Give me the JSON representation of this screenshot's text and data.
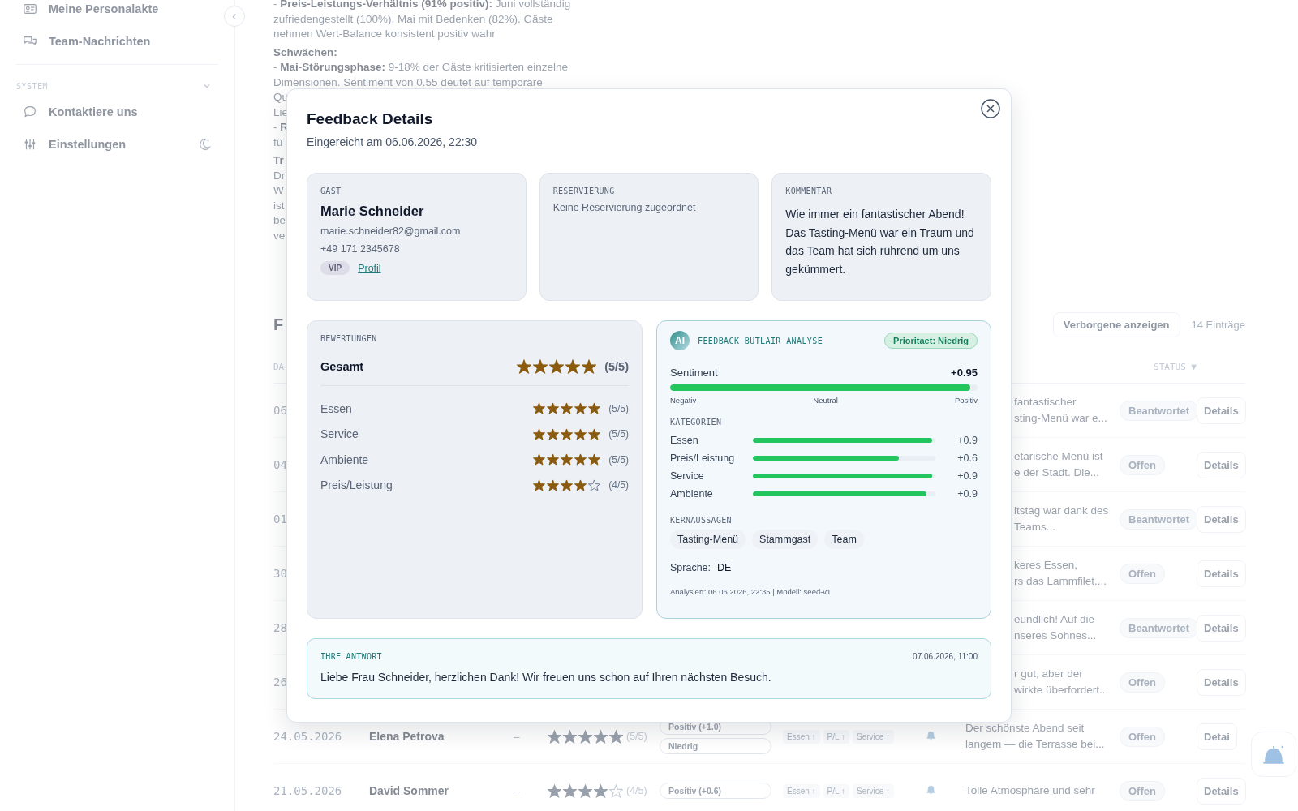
{
  "sidebar": {
    "collapse_toggle": "‹",
    "groups": [
      {
        "items": [
          {
            "label": "Meine Personalakte"
          },
          {
            "label": "Team-Nachrichten"
          }
        ]
      },
      {
        "title": "SYSTEM",
        "expanded": true,
        "items": [
          {
            "label": "Kontaktiere uns"
          },
          {
            "label": "Einstellungen"
          }
        ]
      }
    ]
  },
  "report": {
    "paragraphs": [
      {
        "lines": [
          "- **Preis-Leistungs-Verhältnis (91% positiv):** Juni vollständig",
          "zufriedengestellt (100%), Mai mit Bedenken (82%). Gäste",
          "nehmen Wert-Balance konsistent positiv wahr"
        ]
      },
      {
        "lines": [
          "**Schwächen:**",
          "- **Mai-Störungsphase:** 9-18% der Gäste kritisierten einzelne",
          "Dimensionen. Sentiment von 0.55 deutet auf temporäre",
          "Qu",
          "Lie",
          "- **R**",
          "fü"
        ]
      },
      {
        "lines": [
          "**Tr**",
          "Dr",
          "W",
          "ist",
          "be",
          "ve"
        ]
      }
    ]
  },
  "feedback_list": {
    "title": "F",
    "hidden_toggle": "Verborgene anzeigen",
    "count": "14 Einträge",
    "columns": [
      {
        "label": "DA"
      },
      {
        "label": "STATUS",
        "sort_indicator": "▼"
      }
    ],
    "rows": [
      {
        "date": "06",
        "comment_lines": [
          "fantastischer",
          "sting-Menü war e..."
        ],
        "status": "Beantwortet",
        "action": "Details"
      },
      {
        "date": "04",
        "comment_lines": [
          "etarische Menü ist",
          "e der Stadt. Die..."
        ],
        "status": "Offen",
        "action": "Details"
      },
      {
        "date": "01",
        "comment_lines": [
          "itstag war dank des",
          "Teams..."
        ],
        "status": "Beantwortet",
        "action": "Details"
      },
      {
        "date": "30",
        "comment_lines": [
          "keres Essen,",
          "rs das Lammfilet...."
        ],
        "status": "Offen",
        "action": "Details"
      },
      {
        "date": "28",
        "comment_lines": [
          "eundlich! Auf die",
          "nseres Sohnes..."
        ],
        "status": "Beantwortet",
        "action": "Details"
      },
      {
        "date": "26",
        "comment_lines": [
          "r gut, aber der",
          "wirkte überfordert..."
        ],
        "status": "Offen",
        "action": "Details"
      },
      {
        "date": "24.05.2026",
        "name": "Elena Petrova",
        "reservation": "–",
        "stars": 5,
        "score": "(5/5)",
        "sentiment": "Positiv (+1.0)",
        "priority": "Niedrig",
        "tags": [
          "Essen ↑",
          "P/L ↑",
          "Service ↑"
        ],
        "comment_lines": [
          "Der schönste Abend seit",
          "langem — die Terrasse bei..."
        ],
        "status": "Offen",
        "action": "Detai"
      },
      {
        "date": "21.05.2026",
        "name": "David Sommer",
        "reservation": "–",
        "stars": 4,
        "score": "(4/5)",
        "sentiment": "Positiv (+0.6)",
        "tags": [
          "Essen ↑",
          "P/L ↑",
          "Service ↑"
        ],
        "comment_lines": [
          "Tolle Atmosphäre und sehr"
        ],
        "status": "Offen",
        "action": "Details"
      }
    ]
  },
  "modal": {
    "title": "Feedback Details",
    "subtitle": "Eingereicht am 06.06.2026, 22:30",
    "guest": {
      "label": "GAST",
      "name": "Marie Schneider",
      "email": "marie.schneider82@gmail.com",
      "phone": "+49 171 2345678",
      "badge": "VIP",
      "link": "Profil"
    },
    "reservation": {
      "label": "RESERVIERUNG",
      "text": "Keine Reservierung zugeordnet"
    },
    "comment": {
      "label": "KOMMENTAR",
      "text": "Wie immer ein fantastischer Abend! Das Tasting-Menü war ein Traum und das Team hat sich rührend um uns gekümmert."
    },
    "ratings": {
      "label": "BEWERTUNGEN",
      "overall": {
        "label": "Gesamt",
        "stars": 5,
        "score": "(5/5)"
      },
      "items": [
        {
          "label": "Essen",
          "stars": 5,
          "score": "(5/5)"
        },
        {
          "label": "Service",
          "stars": 5,
          "score": "(5/5)"
        },
        {
          "label": "Ambiente",
          "stars": 5,
          "score": "(5/5)"
        },
        {
          "label": "Preis/Leistung",
          "stars": 4,
          "score": "(4/5)"
        }
      ]
    },
    "analysis": {
      "badge": "AI",
      "title": "FEEDBACK BUTLAIR ANALYSE",
      "priority": "Prioritaet: Niedrig",
      "sentiment": {
        "label": "Sentiment",
        "value": "+0.95",
        "level": 0.975,
        "scale": [
          "Negativ",
          "Neutral",
          "Positiv"
        ]
      },
      "categories_label": "KATEGORIEN",
      "categories": [
        {
          "label": "Essen",
          "level": 0.98,
          "value": "+0.9"
        },
        {
          "label": "Preis/Leistung",
          "level": 0.8,
          "value": "+0.6"
        },
        {
          "label": "Service",
          "level": 0.98,
          "value": "+0.9"
        },
        {
          "label": "Ambiente",
          "level": 0.95,
          "value": "+0.9"
        }
      ],
      "key_points_label": "KERNAUSSAGEN",
      "key_points": [
        "Tasting-Menü",
        "Stammgast",
        "Team"
      ],
      "language_label": "Sprache:",
      "language": "DE",
      "footer": "Analysiert: 06.06.2026, 22:35 | Modell: seed-v1"
    },
    "reply": {
      "label": "IHRE ANTWORT",
      "date": "07.06.2026, 11:00",
      "text": "Liebe Frau Schneider, herzlichen Dank! Wir freuen uns schon auf Ihren nächsten Besuch."
    }
  }
}
